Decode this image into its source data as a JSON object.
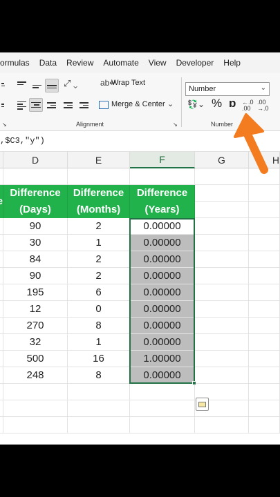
{
  "menu": [
    "ormulas",
    "Data",
    "Review",
    "Automate",
    "View",
    "Developer",
    "Help"
  ],
  "ribbon": {
    "wrap_text": "Wrap Text",
    "merge_center": "Merge & Center",
    "alignment_label": "Alignment",
    "number_format": "Number",
    "number_label": "Number",
    "percent_symbol": "%",
    "comma_symbol": "ɒ"
  },
  "formula_bar": {
    "text": ",$C3,\"y\")"
  },
  "columns": [
    "D",
    "E",
    "F",
    "G",
    "H"
  ],
  "headers": {
    "partial": "e",
    "days": [
      "Difference",
      "(Days)"
    ],
    "months": [
      "Difference",
      "(Months)"
    ],
    "years": [
      "Difference",
      "(Years)"
    ]
  },
  "rows": [
    {
      "days": "90",
      "months": "2",
      "years": "0.00000"
    },
    {
      "days": "30",
      "months": "1",
      "years": "0.00000"
    },
    {
      "days": "84",
      "months": "2",
      "years": "0.00000"
    },
    {
      "days": "90",
      "months": "2",
      "years": "0.00000"
    },
    {
      "days": "195",
      "months": "6",
      "years": "0.00000"
    },
    {
      "days": "12",
      "months": "0",
      "years": "0.00000"
    },
    {
      "days": "270",
      "months": "8",
      "years": "0.00000"
    },
    {
      "days": "32",
      "months": "1",
      "years": "0.00000"
    },
    {
      "days": "500",
      "months": "16",
      "years": "1.00000"
    },
    {
      "days": "248",
      "months": "8",
      "years": "0.00000"
    }
  ],
  "colors": {
    "header_green": "#21b24b",
    "selection_green": "#217346",
    "arrow_orange": "#f47c20"
  }
}
